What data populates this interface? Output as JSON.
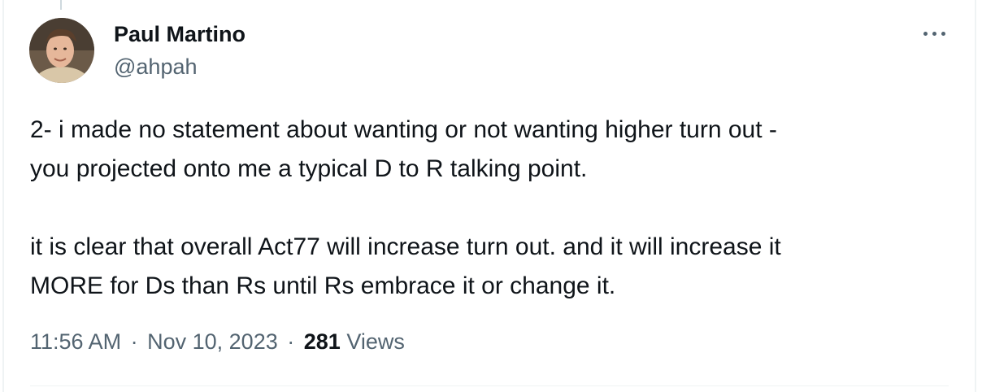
{
  "author": {
    "display_name": "Paul Martino",
    "handle": "@ahpah",
    "avatar": "avatar-photo"
  },
  "tweet": {
    "paragraphs": [
      "2- i made no statement about wanting or not wanting higher turn out -\nyou projected onto me a typical D to R talking point.",
      "it is clear that overall Act77 will increase turn out. and it will increase it\nMORE for Ds than Rs until Rs embrace it or change it."
    ]
  },
  "meta": {
    "time": "11:56 AM",
    "separator": "·",
    "date": "Nov 10, 2023",
    "views_count": "281",
    "views_label": "Views"
  },
  "icons": {
    "more": "more-horizontal-icon"
  },
  "colors": {
    "text_primary": "#0f1419",
    "text_secondary": "#536471",
    "border": "#eff3f4"
  }
}
